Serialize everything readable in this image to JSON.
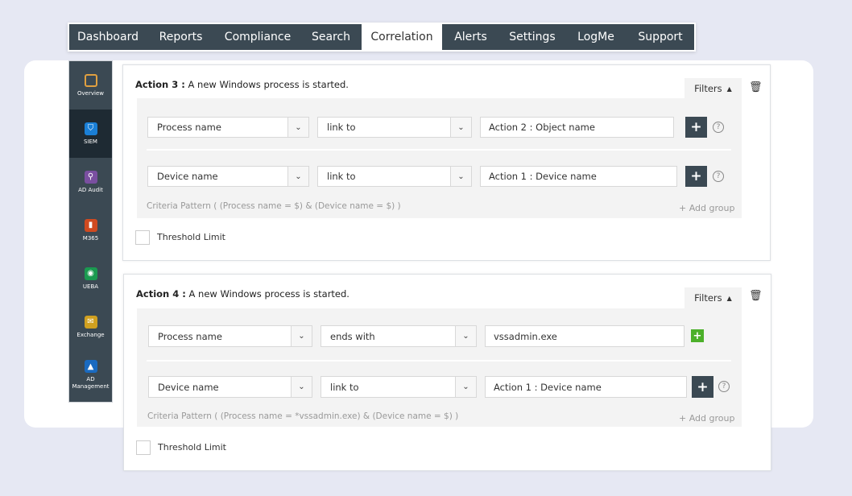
{
  "nav": {
    "tabs": [
      "Dashboard",
      "Reports",
      "Compliance",
      "Search",
      "Correlation",
      "Alerts",
      "Settings",
      "LogMe",
      "Support"
    ],
    "active": "Correlation"
  },
  "sidebar": {
    "items": [
      {
        "label": "Overview",
        "icon": "grid-icon",
        "color": "#e0a040"
      },
      {
        "label": "SIEM",
        "icon": "shield-icon",
        "color": "#1a7fd6"
      },
      {
        "label": "AD Audit",
        "icon": "magnifier-icon",
        "color": "#7a4fa0"
      },
      {
        "label": "M365",
        "icon": "office-icon",
        "color": "#d04a20"
      },
      {
        "label": "UEBA",
        "icon": "eye-icon",
        "color": "#1a9a50"
      },
      {
        "label": "Exchange",
        "icon": "envelope-icon",
        "color": "#d0a020"
      },
      {
        "label": "AD Management",
        "icon": "network-icon",
        "color": "#1a6ac0"
      }
    ],
    "active": "SIEM"
  },
  "actions": [
    {
      "label": "Action 3 :",
      "desc": "A new Windows process is started.",
      "filters": "Filters",
      "rows": [
        {
          "field": "Process name",
          "op": "link to",
          "value": "Action 2 : Object name"
        },
        {
          "field": "Device name",
          "op": "link to",
          "value": "Action 1 : Device name"
        }
      ],
      "criteria": "Criteria Pattern ( (Process name = $) & (Device name = $) )",
      "add_group": "Add group",
      "threshold": "Threshold Limit"
    },
    {
      "label": "Action 4 :",
      "desc": "A new Windows process is started.",
      "filters": "Filters",
      "rows": [
        {
          "field": "Process name",
          "op": "ends with",
          "value": "vssadmin.exe"
        },
        {
          "field": "Device name",
          "op": "link to",
          "value": "Action 1 : Device name"
        }
      ],
      "criteria": "Criteria Pattern ( (Process name = *vssadmin.exe) & (Device name = $) )",
      "add_group": "Add group",
      "threshold": "Threshold Limit"
    }
  ]
}
